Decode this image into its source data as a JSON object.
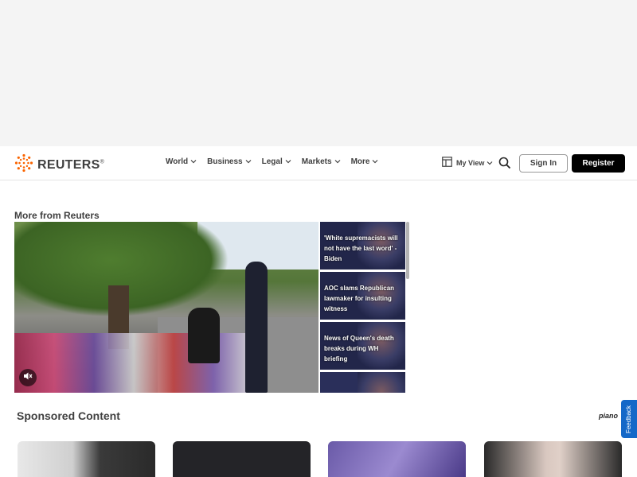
{
  "brand": {
    "name": "REUTERS",
    "mark": "®",
    "accent": "#fa6400"
  },
  "nav": {
    "links": [
      {
        "label": "World"
      },
      {
        "label": "Business"
      },
      {
        "label": "Legal"
      },
      {
        "label": "Markets"
      },
      {
        "label": "More"
      }
    ],
    "my_view_label": "My View",
    "sign_in_label": "Sign In",
    "register_label": "Register"
  },
  "more_from": {
    "title": "More from Reuters",
    "items": [
      {
        "title": "'White supremacists will not have the last word' -Biden"
      },
      {
        "title": "AOC slams Republican lawmaker for insulting witness"
      },
      {
        "title": "News of Queen's death breaks during WH briefing"
      }
    ]
  },
  "sponsored": {
    "title": "Sponsored Content",
    "provider": "piano"
  },
  "feedback_label": "Feedback",
  "icons": {
    "logo": "reuters-logo-icon",
    "chevron": "chevron-down-icon",
    "my_view": "layout-icon",
    "search": "search-icon",
    "mute": "mute-icon"
  }
}
